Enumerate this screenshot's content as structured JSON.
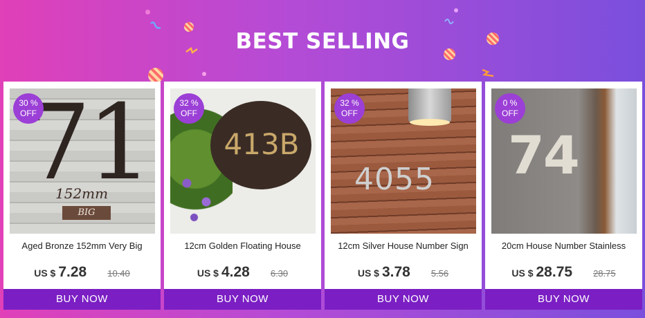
{
  "banner": {
    "title": "BEST SELLING"
  },
  "products": [
    {
      "discount_pct": "30 %",
      "discount_off": "OFF",
      "image_text": "71",
      "image_subtext": "152mm",
      "image_tag": "BIG",
      "name": "Aged Bronze 152mm Very Big",
      "currency": "US $",
      "price": "7.28",
      "old_price": "10.40",
      "button": "BUY NOW"
    },
    {
      "discount_pct": "32 %",
      "discount_off": "OFF",
      "image_text": "413B",
      "name": "12cm Golden Floating House",
      "currency": "US $",
      "price": "4.28",
      "old_price": "6.30",
      "button": "BUY NOW"
    },
    {
      "discount_pct": "32 %",
      "discount_off": "OFF",
      "image_text": "4055",
      "name": "12cm Silver House Number Sign",
      "currency": "US $",
      "price": "3.78",
      "old_price": "5.56",
      "button": "BUY NOW"
    },
    {
      "discount_pct": "0 %",
      "discount_off": "OFF",
      "image_text": "74",
      "name": "20cm House Number Stainless",
      "currency": "US $",
      "price": "28.75",
      "old_price": "28.75",
      "button": "BUY NOW"
    }
  ]
}
